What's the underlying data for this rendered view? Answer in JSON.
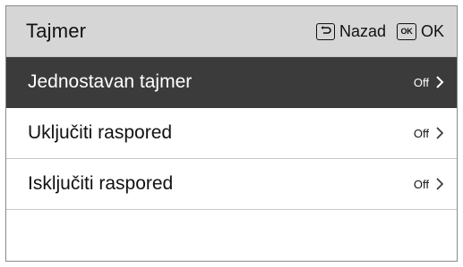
{
  "header": {
    "title": "Tajmer",
    "back_label": "Nazad",
    "ok_key": "OK",
    "ok_label": "OK"
  },
  "menu": {
    "items": [
      {
        "label": "Jednostavan tajmer",
        "value": "Off",
        "selected": true
      },
      {
        "label": "Uključiti raspored",
        "value": "Off",
        "selected": false
      },
      {
        "label": "Isključiti raspored",
        "value": "Off",
        "selected": false
      }
    ]
  },
  "icons": {
    "back": "return-arrow-icon",
    "ok": "ok-key-icon",
    "chevron": "chevron-right-icon"
  },
  "colors": {
    "header_bg": "#d6d6d6",
    "selected_bg": "#3b3b3b",
    "selected_text": "#ffffff",
    "text": "#111111"
  }
}
